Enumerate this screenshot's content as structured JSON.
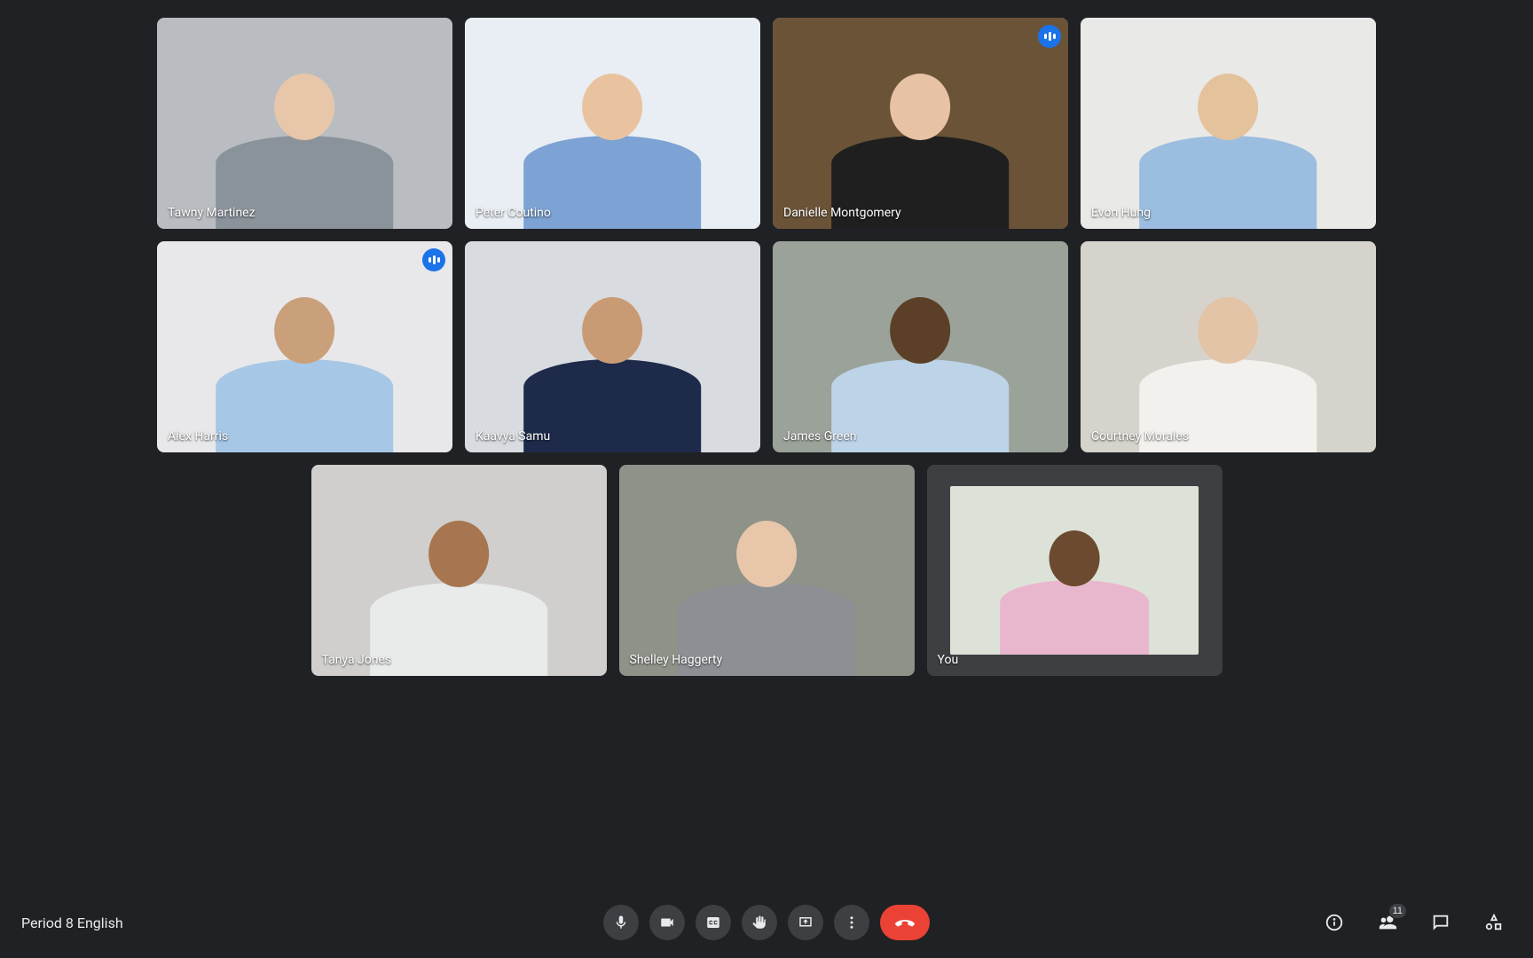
{
  "meeting": {
    "name": "Period 8 English",
    "participant_count": "11"
  },
  "participants": [
    {
      "name": "Tawny Martinez",
      "speaking": false,
      "active": false,
      "self": false,
      "bg": "#b9bdc1",
      "skin": "#e8c6a9",
      "shirt": "#8a929a"
    },
    {
      "name": "Peter Coutino",
      "speaking": false,
      "active": false,
      "self": false,
      "bg": "#e8eef4",
      "skin": "#e9c3a0",
      "shirt": "#7da2d4"
    },
    {
      "name": "Danielle Montgomery",
      "speaking": true,
      "active": true,
      "self": false,
      "bg": "#6b5338",
      "skin": "#e7c2a4",
      "shirt": "#1f1f1f"
    },
    {
      "name": "Evon Hung",
      "speaking": false,
      "active": false,
      "self": false,
      "bg": "#e9e9e7",
      "skin": "#e4c29b",
      "shirt": "#9abde0"
    },
    {
      "name": "Alex Harris",
      "speaking": true,
      "active": false,
      "self": false,
      "bg": "#e8e8ea",
      "skin": "#caa07a",
      "shirt": "#a7c7e6"
    },
    {
      "name": "Kaavya Samu",
      "speaking": false,
      "active": false,
      "self": false,
      "bg": "#d8dbe0",
      "skin": "#c99b74",
      "shirt": "#1d2a4a"
    },
    {
      "name": "James Green",
      "speaking": false,
      "active": false,
      "self": false,
      "bg": "#9ba29a",
      "skin": "#5b4027",
      "shirt": "#bcd3e8"
    },
    {
      "name": "Courtney Morales",
      "speaking": false,
      "active": false,
      "self": false,
      "bg": "#d6d3cc",
      "skin": "#e3c4a6",
      "shirt": "#f3f1ee"
    },
    {
      "name": "Tanya Jones",
      "speaking": false,
      "active": false,
      "self": false,
      "bg": "#d0cfcd",
      "skin": "#a7754f",
      "shirt": "#e9eaea"
    },
    {
      "name": "Shelley Haggerty",
      "speaking": false,
      "active": false,
      "self": false,
      "bg": "#8e9289",
      "skin": "#e8c6aa",
      "shirt": "#8c8f93"
    },
    {
      "name": "You",
      "speaking": false,
      "active": false,
      "self": true,
      "bg": "#dde2d8",
      "skin": "#6b4a30",
      "shirt": "#e9b7cd"
    }
  ],
  "controls": {
    "mic": {
      "label": "Microphone"
    },
    "camera": {
      "label": "Camera"
    },
    "captions": {
      "label": "Captions"
    },
    "raisehand": {
      "label": "Raise hand"
    },
    "present": {
      "label": "Present"
    },
    "more": {
      "label": "More options"
    },
    "leave": {
      "label": "Leave call"
    }
  },
  "side_controls": {
    "info": {
      "label": "Meeting details"
    },
    "people": {
      "label": "People"
    },
    "chat": {
      "label": "Chat"
    },
    "activities": {
      "label": "Activities"
    }
  }
}
